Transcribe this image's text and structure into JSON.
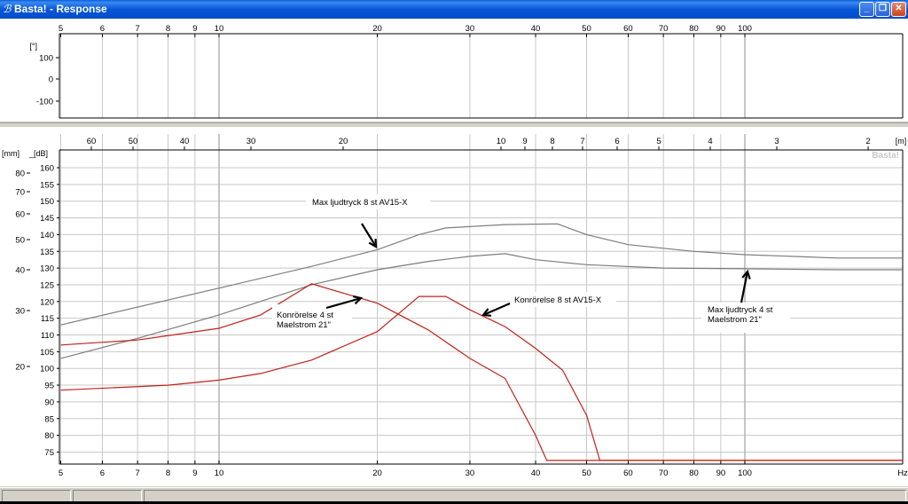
{
  "window": {
    "title": "Basta! - Response",
    "icon": "basta-app-icon",
    "buttons": {
      "minimize": "_",
      "maximize": "❐",
      "close": "✕"
    }
  },
  "colors": {
    "pressure": "#7c7c7c",
    "excursion": "#c0201a",
    "grid": "#c8c8c8",
    "annotation_arrow": "#000000",
    "background": "#ffffff"
  },
  "chart_data": [
    {
      "type": "line",
      "name": "phase-panel",
      "xscale": "log",
      "xlim": [
        5,
        200
      ],
      "x_ticks": [
        5,
        6,
        7,
        8,
        9,
        10,
        20,
        30,
        40,
        50,
        60,
        70,
        80,
        90,
        100
      ],
      "ylabel": "[°]",
      "y_ticks": [
        100,
        0,
        -100
      ],
      "ylim": [
        -170,
        190
      ],
      "series": []
    },
    {
      "type": "line",
      "name": "response-panel",
      "xscale": "log",
      "xlim": [
        5,
        200
      ],
      "x_ticks": [
        5,
        6,
        7,
        8,
        9,
        10,
        20,
        30,
        40,
        50,
        60,
        70,
        80,
        90,
        100
      ],
      "xunit": "Hz",
      "top_axis": {
        "unit": "[m]",
        "labels": [
          "60",
          "50",
          "40",
          "30",
          "20",
          "10",
          "9",
          "8",
          "7",
          "6",
          "5",
          "4",
          "3",
          "2"
        ],
        "values": [
          60,
          50,
          40,
          30,
          20,
          10,
          9,
          8,
          7,
          6,
          5,
          4,
          3,
          2
        ]
      },
      "y_right": {
        "label": "[dB]",
        "ticks": [
          75,
          80,
          85,
          90,
          95,
          100,
          105,
          110,
          115,
          120,
          125,
          130,
          135,
          140,
          145,
          150,
          155,
          160
        ],
        "ylim": [
          72.5,
          163.5
        ]
      },
      "y_left": {
        "label": "[mm]",
        "ticks": [
          20,
          30,
          40,
          50,
          60,
          70,
          80
        ],
        "scale": "log"
      },
      "watermark": "Basta!",
      "series": [
        {
          "kind": "pressure",
          "x": [
            5,
            10,
            15,
            20,
            24,
            27,
            35,
            44,
            50,
            60,
            80,
            100,
            150,
            200
          ],
          "y": [
            113,
            124,
            130.5,
            135.5,
            140,
            142,
            143,
            143.2,
            140,
            137,
            135,
            134,
            133,
            133
          ]
        },
        {
          "kind": "pressure",
          "x": [
            5,
            7,
            10,
            15,
            20,
            25,
            30,
            35,
            40,
            50,
            70,
            100,
            150,
            200
          ],
          "y": [
            103,
            109,
            116,
            125,
            129.5,
            132,
            133.5,
            134.3,
            132.5,
            131,
            130,
            129.8,
            129.5,
            129.5
          ]
        },
        {
          "kind": "excursion",
          "x": [
            5,
            7,
            10,
            12,
            15,
            20,
            25,
            30,
            35,
            40,
            42,
            200
          ],
          "y": [
            107,
            108.5,
            112,
            116,
            125.3,
            119.5,
            111.5,
            103,
            97,
            80,
            72.5,
            72.5
          ]
        },
        {
          "kind": "excursion",
          "x": [
            5,
            8,
            10,
            12,
            15,
            20,
            24,
            27,
            30,
            35,
            40,
            45,
            50,
            53,
            200
          ],
          "y": [
            93.5,
            95,
            96.5,
            98.5,
            102.5,
            111,
            121.5,
            121.5,
            117.5,
            112.5,
            106,
            99.5,
            86,
            72.5,
            72.5
          ]
        }
      ],
      "annotations": [
        {
          "text": [
            "Max ljudtryck 8 st AV15-X"
          ]
        },
        {
          "text": [
            "Konrörelse 4 st",
            "Maelstrom 21\""
          ]
        },
        {
          "text": [
            "Konrörelse 8 st AV15-X"
          ]
        },
        {
          "text": [
            "Max ljudtryck 4 st",
            "Maelstrom 21\""
          ]
        }
      ]
    }
  ]
}
